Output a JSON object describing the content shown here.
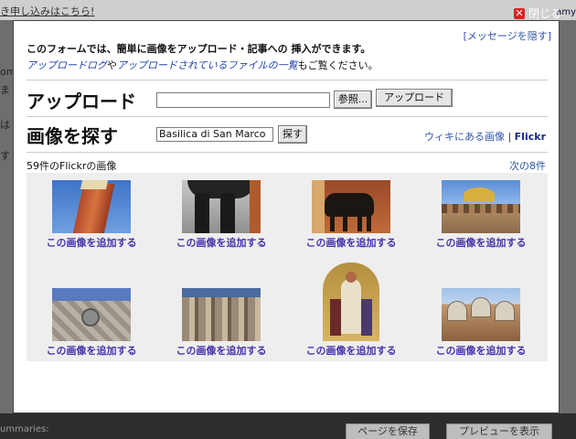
{
  "background": {
    "top_link": "き申し込みはこちら!",
    "side_letters": [
      "om",
      "ま",
      "は",
      "す"
    ],
    "right_tag": "amy",
    "summaries": "ummaries:",
    "save_button": "ページを保存",
    "preview_button": "プレビューを表示"
  },
  "modal": {
    "close_label": "閉じる",
    "hide_message": "[メッセージを隠す]",
    "intro_line1": "このフォームでは、簡単に画像をアップロード・記事への 挿入ができます。",
    "intro_link1": "アップロードログ",
    "intro_mid": "や",
    "intro_link2": "アップロードされているファイルの一覧",
    "intro_end": "もご覧ください。",
    "upload": {
      "title": "アップロード",
      "browse_button": "参照...",
      "upload_button": "アップロード"
    },
    "search": {
      "title": "画像を探す",
      "query": "Basilica di San Marco",
      "search_button": "探す",
      "wiki_link": "ウィキにある画像",
      "divider": " | ",
      "flickr_link": "Flickr"
    },
    "results": {
      "count_text": "59件のFlickrの画像",
      "next_link": "次の8件",
      "add_label": "この画像を追加する",
      "items": [
        {
          "name": "campanile-tower"
        },
        {
          "name": "horse-legs"
        },
        {
          "name": "horses-of-san-marco"
        },
        {
          "name": "winged-lion"
        },
        {
          "name": "marble-facade"
        },
        {
          "name": "carved-columns"
        },
        {
          "name": "mosaic-saint"
        },
        {
          "name": "basilica-domes"
        }
      ]
    }
  }
}
